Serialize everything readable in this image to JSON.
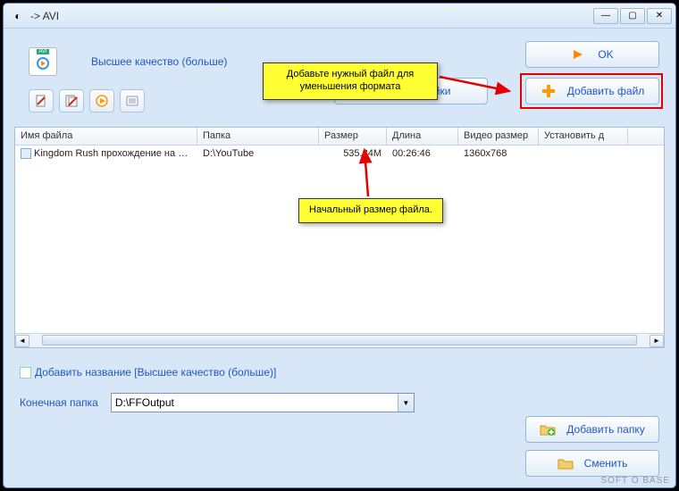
{
  "title": " -> AVI",
  "quality_link": "Высшее качество (больше)",
  "buttons": {
    "ok": "OK",
    "add_file": "Добавить файл",
    "settings": "Настройки",
    "add_folder": "Добавить папку",
    "change": "Сменить"
  },
  "table": {
    "headers": {
      "filename": "Имя файла",
      "folder": "Папка",
      "size": "Размер",
      "length": "Длина",
      "video_size": "Видео размер",
      "set": "Установить д"
    },
    "row": {
      "filename": "Kingdom Rush прохождение на ПК ...",
      "folder": "D:\\YouTube",
      "size": "535.84M",
      "length": "00:26:46",
      "video_size": "1360x768",
      "set": ""
    }
  },
  "add_title": {
    "label": "Добавить название [Высшее качество (больше)]"
  },
  "output": {
    "label": "Конечная папка",
    "value": "D:\\FFOutput"
  },
  "callouts": {
    "c1": "Добавьте нужный файл для уменьшения формата",
    "c2": "Начальный размер файла."
  },
  "watermark": "SOFT O BASE"
}
